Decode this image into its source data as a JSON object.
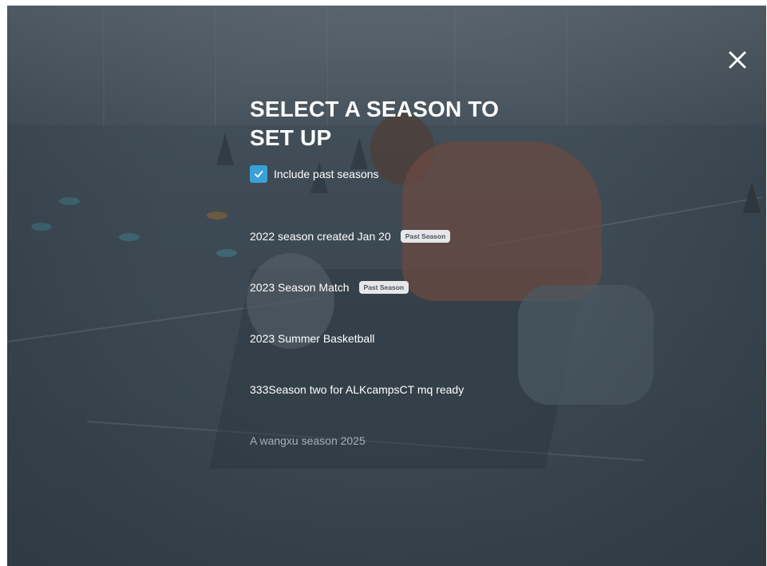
{
  "dialog": {
    "title": "SELECT A SEASON TO SET UP",
    "close_icon": "close-icon"
  },
  "include_past": {
    "label": "Include past seasons",
    "checked": true,
    "accent_color": "#3aa0d8"
  },
  "seasons": [
    {
      "name": "2022 season created Jan 20",
      "badge": "Past Season"
    },
    {
      "name": "2023 Season Match",
      "badge": "Past Season"
    },
    {
      "name": "2023 Summer Basketball",
      "badge": ""
    },
    {
      "name": "333Season two for ALKcampsCT mq ready",
      "badge": ""
    },
    {
      "name": "A wangxu season 2025",
      "badge": ""
    }
  ]
}
